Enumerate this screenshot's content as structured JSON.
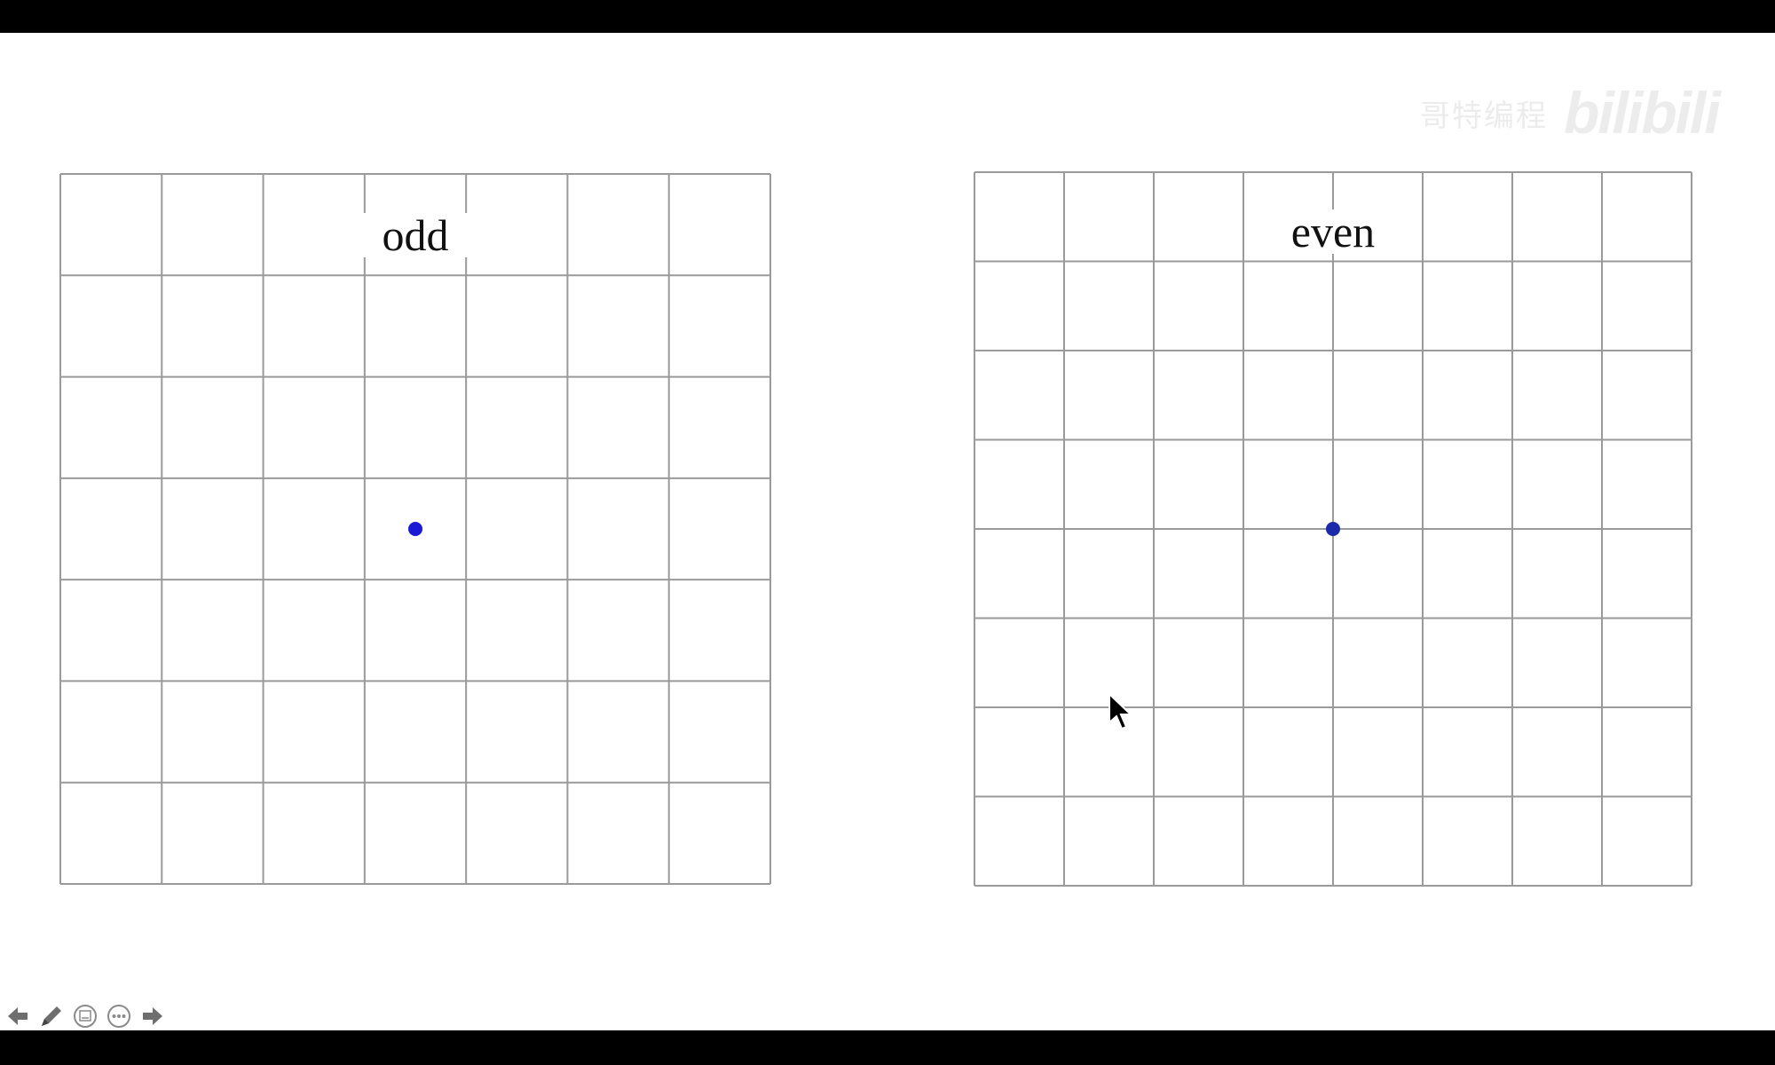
{
  "slide": {
    "left_grid": {
      "label": "odd",
      "rows": 7,
      "cols": 7
    },
    "right_grid": {
      "label": "even",
      "rows": 8,
      "cols": 8
    }
  },
  "watermark": {
    "text": "哥特编程",
    "logo": "bilibili"
  },
  "toolbar": {
    "buttons": [
      {
        "icon": "arrow-left-icon"
      },
      {
        "icon": "pen-icon"
      },
      {
        "icon": "slide-view-icon"
      },
      {
        "icon": "more-options-icon"
      },
      {
        "icon": "arrow-right-icon"
      }
    ]
  },
  "colors": {
    "grid_line": "#9a9a9a",
    "dot": "#1a1ad6",
    "dot_even": "#1a2aa8",
    "toolbar_icon": "#6e6e6e"
  }
}
